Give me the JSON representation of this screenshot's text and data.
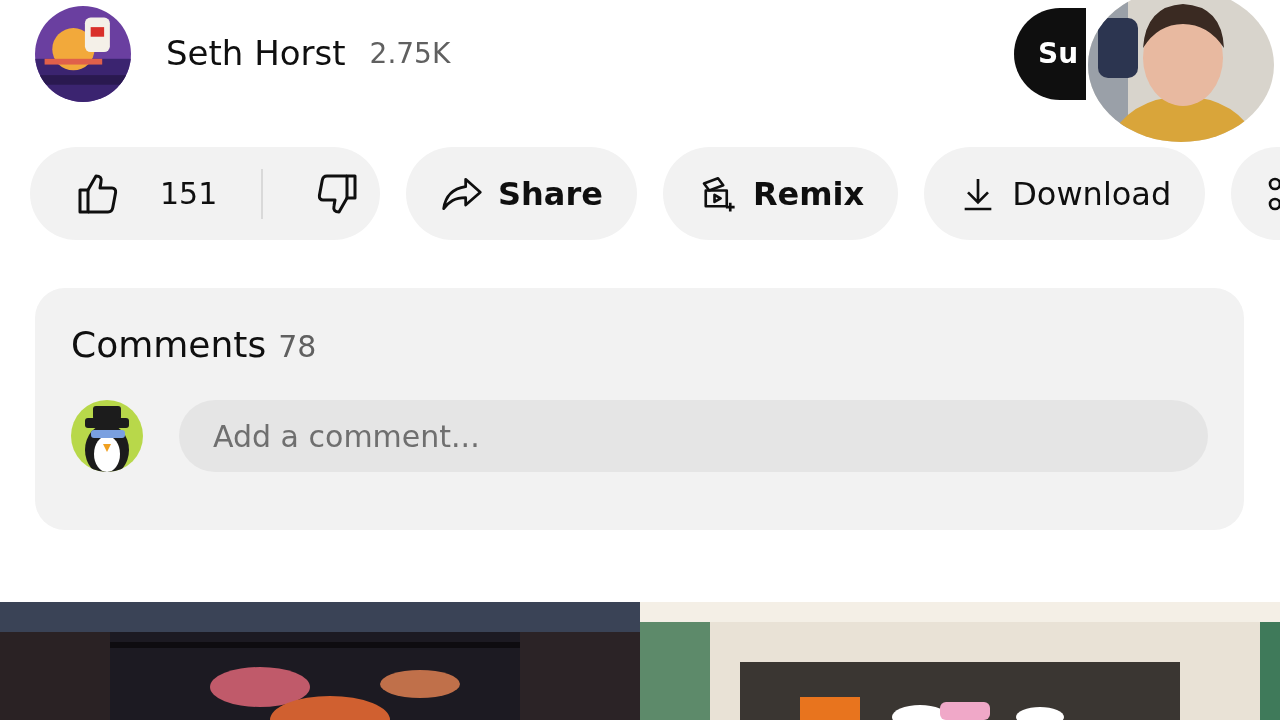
{
  "channel": {
    "name": "Seth Horst",
    "subscribers": "2.75K",
    "subscribe_button": {
      "label": "Su"
    }
  },
  "actions": [
    {
      "kind": "like",
      "count": "151"
    },
    {
      "kind": "share",
      "label": "Share",
      "bold": true
    },
    {
      "kind": "remix",
      "label": "Remix",
      "bold": true
    },
    {
      "kind": "download",
      "label": "Download",
      "bold": false
    },
    {
      "kind": "more"
    }
  ],
  "comments": {
    "title": "Comments",
    "count": "78",
    "placeholder": "Add a comment..."
  }
}
